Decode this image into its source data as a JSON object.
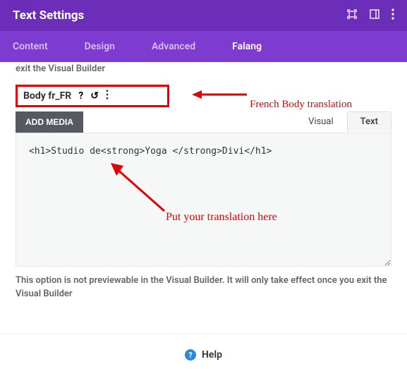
{
  "header": {
    "title": "Text Settings"
  },
  "tabs": {
    "content": "Content",
    "design": "Design",
    "advanced": "Advanced",
    "falang": "Falang"
  },
  "truncated_note": "exit the Visual Builder",
  "field": {
    "label": "Body fr_FR"
  },
  "annotations": {
    "title": "French Body translation",
    "editor": "Put your translation here"
  },
  "editor": {
    "add_media": "ADD MEDIA",
    "tab_visual": "Visual",
    "tab_text": "Text",
    "content": "<h1>Studio de<strong>Yoga </strong>Divi</h1>"
  },
  "preview_note": "This option is not previewable in the Visual Builder. It will only take effect once you exit the Visual Builder",
  "footer": {
    "help": "Help"
  }
}
